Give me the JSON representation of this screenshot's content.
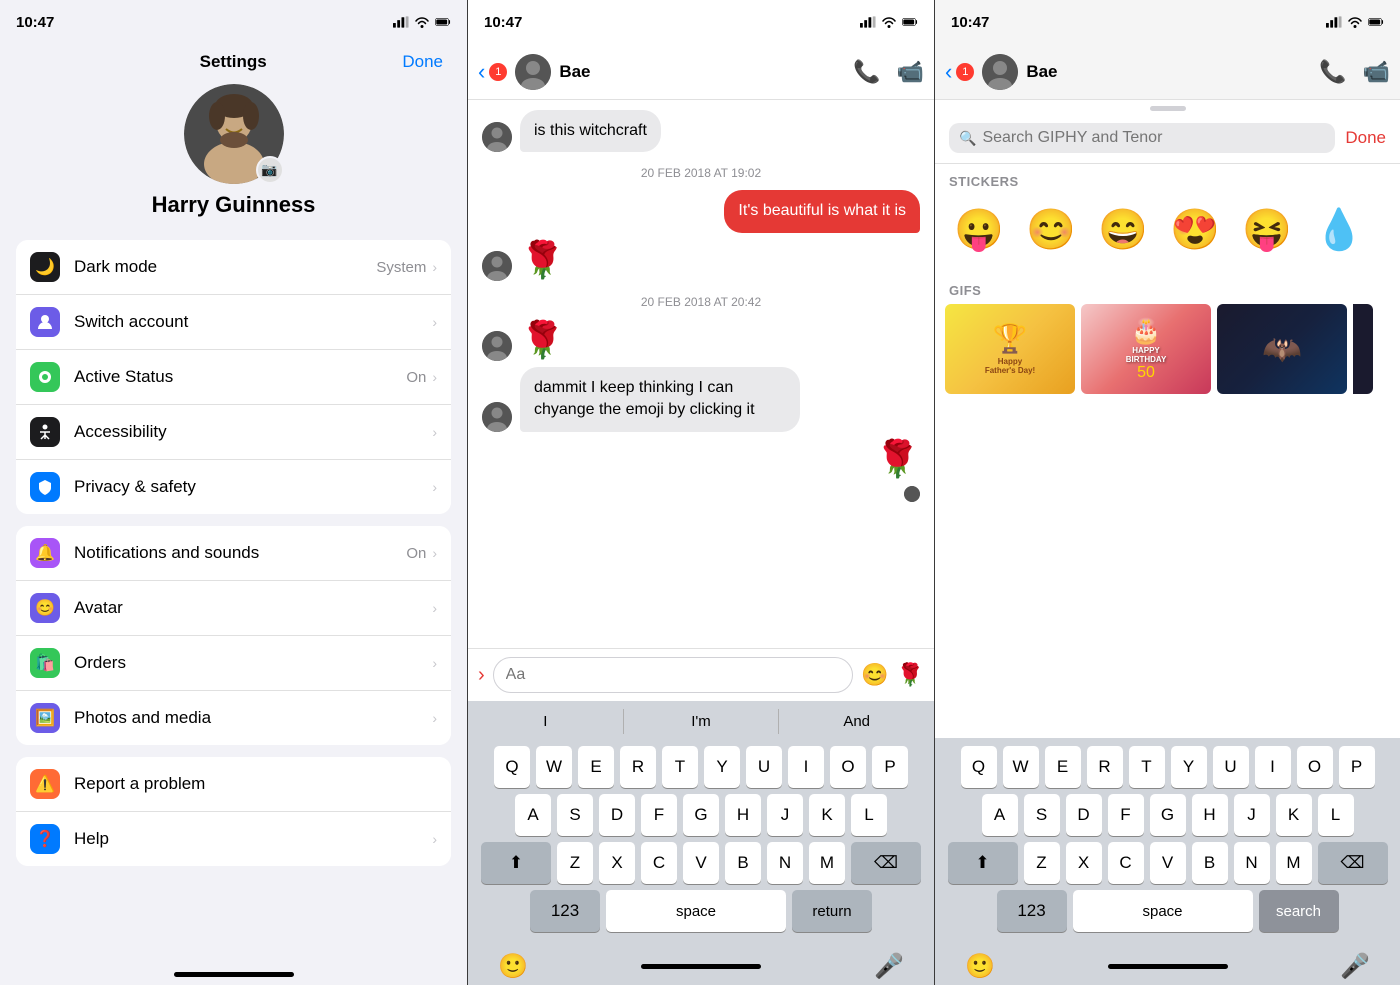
{
  "status": {
    "time": "10:47",
    "signal_bars": "▂▄▆",
    "wifi": "wifi",
    "battery": "battery"
  },
  "settings": {
    "title": "Settings",
    "done_label": "Done",
    "user_name": "Harry Guinness",
    "items_section1": [
      {
        "icon": "🌙",
        "icon_bg": "#1c1c1e",
        "label": "Dark mode",
        "value": "System",
        "has_chevron": true
      },
      {
        "icon": "👤",
        "icon_bg": "#6c5ce7",
        "label": "Switch account",
        "value": "",
        "has_chevron": true
      },
      {
        "icon": "🟢",
        "icon_bg": "#34c759",
        "label": "Active Status",
        "value": "On",
        "has_chevron": true
      },
      {
        "icon": "⚙️",
        "icon_bg": "#1c1c1e",
        "label": "Accessibility",
        "value": "",
        "has_chevron": true
      },
      {
        "icon": "🏠",
        "icon_bg": "#007aff",
        "label": "Privacy & safety",
        "value": "",
        "has_chevron": true
      }
    ],
    "items_section2": [
      {
        "icon": "🔔",
        "icon_bg": "#a855f7",
        "label": "Notifications and sounds",
        "value": "On",
        "has_chevron": true
      },
      {
        "icon": "😊",
        "icon_bg": "#6c5ce7",
        "label": "Avatar",
        "value": "",
        "has_chevron": true
      },
      {
        "icon": "🛍️",
        "icon_bg": "#34c759",
        "label": "Orders",
        "value": "",
        "has_chevron": true
      },
      {
        "icon": "🖼️",
        "icon_bg": "#6c5ce7",
        "label": "Photos and media",
        "value": "",
        "has_chevron": true
      }
    ],
    "items_section3": [
      {
        "icon": "⚠️",
        "icon_bg": "#ff6b35",
        "label": "Report a problem",
        "value": "",
        "has_chevron": false
      },
      {
        "icon": "❓",
        "icon_bg": "#007aff",
        "label": "Help",
        "value": "",
        "has_chevron": true
      }
    ]
  },
  "chat": {
    "contact_name": "Bae",
    "messages": [
      {
        "from": "them",
        "text": "is this witchcraft",
        "type": "text"
      },
      {
        "timestamp": "20 FEB 2018 AT 19:02"
      },
      {
        "from": "mine",
        "text": "It's beautiful is what it is",
        "type": "text"
      },
      {
        "from": "them",
        "emoji": "🌹",
        "type": "emoji"
      },
      {
        "timestamp": "20 FEB 2018 AT 20:42"
      },
      {
        "from": "them",
        "emoji": "🌹",
        "type": "emoji"
      },
      {
        "from": "them",
        "text": "dammit I keep thinking I can chyange the emoji by clicking it",
        "type": "text"
      },
      {
        "from": "mine",
        "emoji": "🌹",
        "type": "emoji"
      }
    ],
    "input_placeholder": "Aa",
    "word_suggestions": [
      "I",
      "I'm",
      "And"
    ],
    "keyboard_rows": [
      [
        "Q",
        "W",
        "E",
        "R",
        "T",
        "Y",
        "U",
        "I",
        "O",
        "P"
      ],
      [
        "A",
        "S",
        "D",
        "F",
        "G",
        "H",
        "J",
        "K",
        "L"
      ],
      [
        "⬆",
        "Z",
        "X",
        "C",
        "V",
        "B",
        "N",
        "M",
        "⌫"
      ],
      [
        "123",
        "space",
        "return"
      ]
    ]
  },
  "giphy": {
    "search_placeholder": "Search GIPHY and Tenor",
    "done_label": "Done",
    "stickers_label": "STICKERS",
    "stickers": [
      "😛",
      "😊",
      "😄",
      "😍",
      "😝",
      "💧"
    ],
    "gifs_label": "GIFS",
    "gifs": [
      {
        "label": "Happy Father's Day!"
      },
      {
        "label": "HAPPY BIRTHDAY"
      },
      {
        "label": ""
      }
    ],
    "keyboard_rows": [
      [
        "Q",
        "W",
        "E",
        "R",
        "T",
        "Y",
        "U",
        "I",
        "O",
        "P"
      ],
      [
        "A",
        "S",
        "D",
        "F",
        "G",
        "H",
        "J",
        "K",
        "L"
      ],
      [
        "⬆",
        "Z",
        "X",
        "C",
        "V",
        "B",
        "N",
        "M",
        "⌫"
      ],
      [
        "123",
        "space",
        "search"
      ]
    ]
  }
}
